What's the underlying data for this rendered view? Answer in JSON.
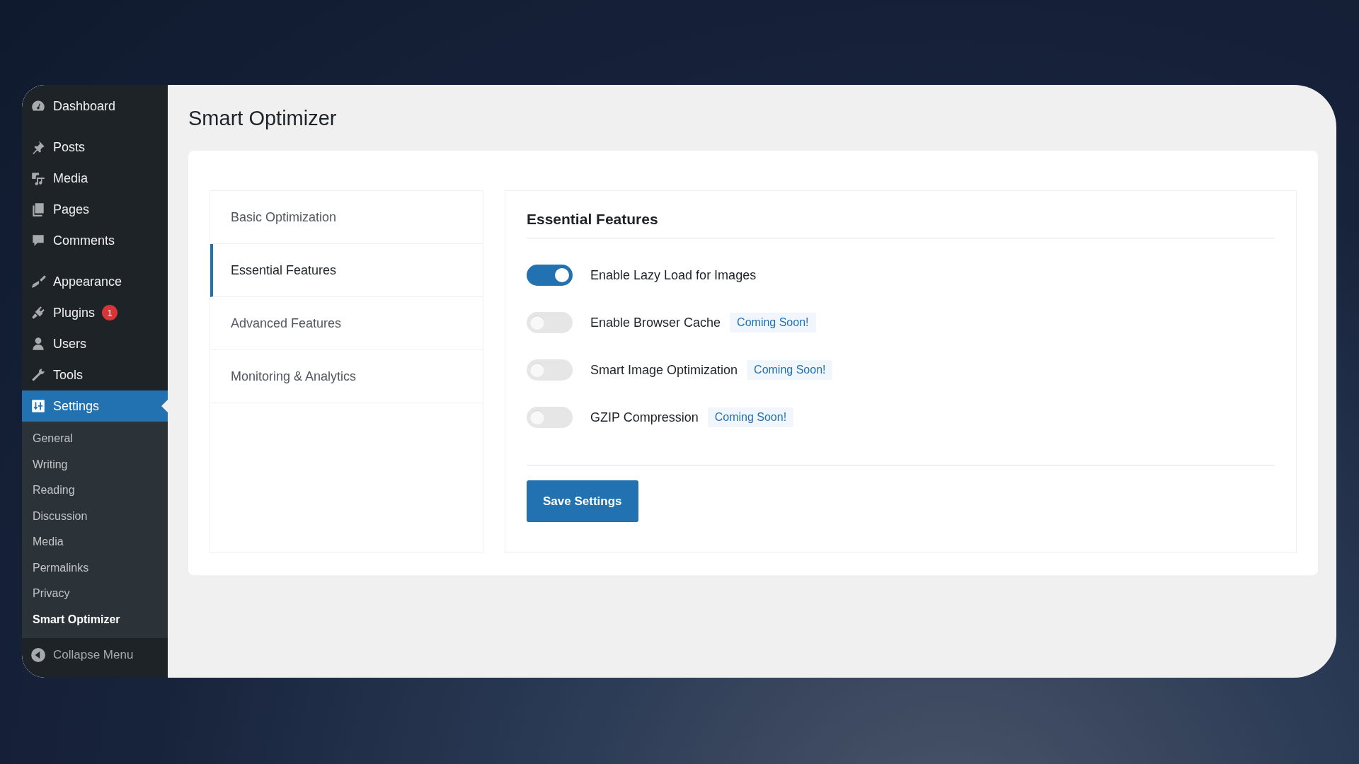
{
  "sidebar": {
    "items": [
      {
        "label": "Dashboard",
        "selected": false
      },
      {
        "label": "Posts",
        "selected": false
      },
      {
        "label": "Media",
        "selected": false
      },
      {
        "label": "Pages",
        "selected": false
      },
      {
        "label": "Comments",
        "selected": false
      },
      {
        "label": "Appearance",
        "selected": false
      },
      {
        "label": "Plugins",
        "selected": false,
        "badge": "1"
      },
      {
        "label": "Users",
        "selected": false
      },
      {
        "label": "Tools",
        "selected": false
      },
      {
        "label": "Settings",
        "selected": true,
        "submenu": [
          {
            "label": "General",
            "selected": false
          },
          {
            "label": "Writing",
            "selected": false
          },
          {
            "label": "Reading",
            "selected": false
          },
          {
            "label": "Discussion",
            "selected": false
          },
          {
            "label": "Media",
            "selected": false
          },
          {
            "label": "Permalinks",
            "selected": false
          },
          {
            "label": "Privacy",
            "selected": false
          },
          {
            "label": "Smart Optimizer",
            "selected": true
          }
        ]
      }
    ],
    "collapse": "Collapse Menu"
  },
  "page_title": "Smart Optimizer",
  "tabs": [
    {
      "label": "Basic Optimization",
      "selected": false
    },
    {
      "label": "Essential Features",
      "selected": true
    },
    {
      "label": "Advanced Features",
      "selected": false
    },
    {
      "label": "Monitoring & Analytics",
      "selected": false
    }
  ],
  "section": {
    "heading": "Essential Features",
    "options": [
      {
        "label": "Enable Lazy Load for Images",
        "on": true,
        "disabled": false
      },
      {
        "label": "Enable Browser Cache",
        "on": false,
        "disabled": true,
        "badge": "Coming Soon!"
      },
      {
        "label": "Smart Image Optimization",
        "on": false,
        "disabled": true,
        "badge": "Coming Soon!"
      },
      {
        "label": "GZIP Compression",
        "on": false,
        "disabled": true,
        "badge": "Coming Soon!"
      }
    ],
    "save_button": "Save Settings"
  }
}
